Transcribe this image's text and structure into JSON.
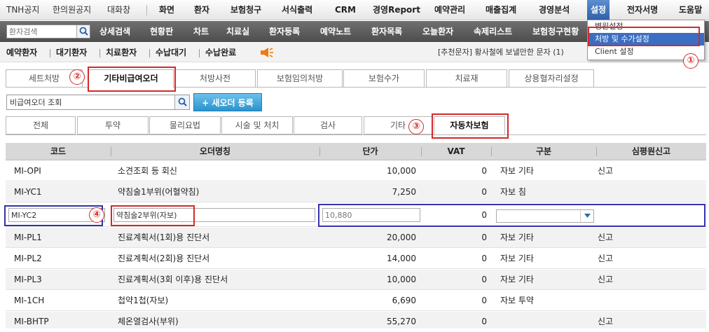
{
  "topnav": {
    "items": [
      "TNH공지",
      "한의원공지",
      "대화창",
      "화면",
      "환자",
      "보험청구",
      "서식출력",
      "CRM",
      "경영Report",
      "예약관리",
      "매출집계",
      "경영분석",
      "설정",
      "전자서명",
      "도움말"
    ]
  },
  "subnav": {
    "search_placeholder": "환자검색",
    "items": [
      "상세검색",
      "현황판",
      "차트",
      "치료실",
      "환자등록",
      "예약노트",
      "환자목록",
      "오늘환자",
      "속제리스트",
      "보험청구현황"
    ]
  },
  "quickbar": {
    "items": [
      "예약환자",
      "대기환자",
      "치료환자",
      "수납대기",
      "수납완료"
    ],
    "notice": "[추천문자] 황사철에 보낼만한 문자 (1)"
  },
  "dropdown": {
    "items": [
      "병원설정",
      "처방 및 수가설정",
      "Client 설정"
    ]
  },
  "tabs1": [
    "세트처방",
    "기타비급여오더",
    "처방사전",
    "보험임의처방",
    "보험수가",
    "치료재",
    "상용혈자리설정"
  ],
  "order_search": {
    "value": "비급여오더 조회"
  },
  "new_order_button": "+ 새오더 등록",
  "tabs2": [
    "전체",
    "투약",
    "물리요법",
    "시술 및 처치",
    "검사",
    "기타",
    "자동차보험"
  ],
  "table": {
    "columns": [
      "코드",
      "오더명칭",
      "단가",
      "VAT",
      "구분",
      "심평원신고"
    ],
    "rows": [
      {
        "code": "MI-OPI",
        "name": "소견조회 등 회신",
        "price": "10,000",
        "vat": "0",
        "category": "자보 기타",
        "report": "신고"
      },
      {
        "code": "MI-YC1",
        "name": "약침술1부위(어혈약침)",
        "price": "7,250",
        "vat": "0",
        "category": "자보 침",
        "report": ""
      },
      {
        "code": "MI-YC2",
        "name": "약침술2부위(자보)",
        "price": "10,880",
        "vat": "0",
        "category": "",
        "report": ""
      },
      {
        "code": "MI-PL1",
        "name": "진료계획서(1회)용 진단서",
        "price": "20,000",
        "vat": "0",
        "category": "자보 기타",
        "report": "신고"
      },
      {
        "code": "MI-PL2",
        "name": "진료계획서(2회)용 진단서",
        "price": "14,000",
        "vat": "0",
        "category": "자보 기타",
        "report": "신고"
      },
      {
        "code": "MI-PL3",
        "name": "진료계획서(3회 이후)용 진단서",
        "price": "10,000",
        "vat": "0",
        "category": "자보 기타",
        "report": "신고"
      },
      {
        "code": "MI-1CH",
        "name": "첩약1첩(자보)",
        "price": "6,690",
        "vat": "0",
        "category": "자보 투약",
        "report": ""
      },
      {
        "code": "MI-BHTP",
        "name": "체온열검사(부위)",
        "price": "55,270",
        "vat": "0",
        "category": "",
        "report": "신고"
      }
    ]
  },
  "annotations": [
    "①",
    "②",
    "③",
    "④"
  ],
  "colors": {
    "annotation_red": "#d22a2a",
    "annotation_blue": "#3333aa",
    "active_menu": "#3a6ec2",
    "button_blue": "#2a93cf"
  }
}
